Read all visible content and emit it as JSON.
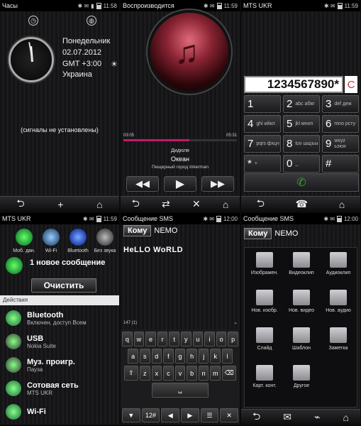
{
  "p1": {
    "title": "Часы",
    "time": "11:58",
    "day": "Понедельник",
    "date": "02.07.2012",
    "tz": "GMT +3:00",
    "country": "Украина",
    "alarms": "(сигналы не установлены)",
    "soft": [
      "⮌",
      "+",
      "⌂"
    ]
  },
  "p2": {
    "title": "Воспроизводится",
    "time": "11:59",
    "elapsed": "03:05",
    "total": "05:31",
    "progress": 0.58,
    "artist": "Дидюля",
    "song": "Океан",
    "album": "Пещерный город Inkerman",
    "controls": [
      "◀◀",
      "▶",
      "▶▶"
    ],
    "soft": [
      "⮌",
      "⇄",
      "✕",
      "⌂"
    ]
  },
  "p3": {
    "title": "MTS UKR",
    "time": "11:59",
    "number": "1234567890*",
    "clear": "C",
    "keys": [
      {
        "d": "1",
        "l": ""
      },
      {
        "d": "2",
        "l": "abc абвг"
      },
      {
        "d": "3",
        "l": "def деж"
      },
      {
        "d": "4",
        "l": "ghi ийкл"
      },
      {
        "d": "5",
        "l": "jkl мноп"
      },
      {
        "d": "6",
        "l": "mno рсту"
      },
      {
        "d": "7",
        "l": "pqrs фхцч"
      },
      {
        "d": "8",
        "l": "tuv шщъы"
      },
      {
        "d": "9",
        "l": "wxyz ьэюя"
      },
      {
        "d": "*",
        "l": "+"
      },
      {
        "d": "0",
        "l": "_"
      },
      {
        "d": "#",
        "l": ""
      }
    ],
    "soft": [
      "⮌",
      "☎",
      "⌂"
    ]
  },
  "p4": {
    "title": "MTS UKR",
    "time": "11:59",
    "toggles": [
      "Моб. дан.",
      "Wi-Fi",
      "Bluetooth",
      "Без звука"
    ],
    "message": "1 новое сообщение",
    "clear": "Очистить",
    "actions": "Действия",
    "rows": [
      {
        "t1": "Bluetooth",
        "t2": "Включен, доступ Всем",
        "c": "#1a6a3a"
      },
      {
        "t1": "USB",
        "t2": "Nokia Suite",
        "c": "#333"
      },
      {
        "t1": "Муз. проигр.",
        "t2": "Пауза",
        "c": "#333"
      },
      {
        "t1": "Сотовая сеть",
        "t2": "MTS UKR",
        "c": "#1a6a3a"
      },
      {
        "t1": "Wi-Fi",
        "t2": "",
        "c": "#1a6a3a"
      }
    ]
  },
  "p5": {
    "title": "Сообщение SMS",
    "time": "12:00",
    "to": "Кому",
    "recipient": "NEMO",
    "text": "HeLLO WoRLD",
    "counter": "147 (1)",
    "keys": [
      [
        "q",
        "w",
        "e",
        "r",
        "t",
        "y",
        "u",
        "i",
        "o",
        "p"
      ],
      [
        "a",
        "s",
        "d",
        "f",
        "g",
        "h",
        "j",
        "k",
        "l"
      ],
      [
        "z",
        "x",
        "c",
        "v",
        "b",
        "n",
        "m"
      ]
    ],
    "bottom": [
      "▼",
      "12#",
      "◀",
      "▶",
      "☰",
      "✕"
    ]
  },
  "p6": {
    "title": "Сообщение SMS",
    "time": "12:00",
    "to": "Кому",
    "recipient": "NEMO",
    "items": [
      "Изображен.",
      "Видеоклип",
      "Аудиоклип",
      "Нов. изобр.",
      "Нов. видео",
      "Нов. аудио",
      "Слайд",
      "Шаблон",
      "Заметка",
      "Карт. конт.",
      "Другое"
    ]
  }
}
